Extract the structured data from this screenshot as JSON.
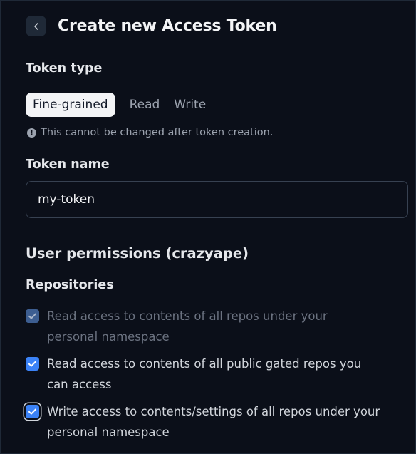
{
  "header": {
    "back_icon": "chevron-left-icon",
    "title": "Create new Access Token"
  },
  "token_type": {
    "label": "Token type",
    "tabs": [
      {
        "label": "Fine-grained",
        "selected": true
      },
      {
        "label": "Read",
        "selected": false
      },
      {
        "label": "Write",
        "selected": false
      }
    ],
    "note_icon": "exclamation-circle-icon",
    "note": "This cannot be changed after token creation."
  },
  "token_name": {
    "label": "Token name",
    "value": "my-token"
  },
  "permissions": {
    "title": "User permissions (crazyape)",
    "repositories": {
      "label": "Repositories",
      "items": [
        {
          "label": "Read access to contents of all repos under your personal namespace",
          "checked": true,
          "disabled": true
        },
        {
          "label": "Read access to contents of all public gated repos you can access",
          "checked": true,
          "disabled": false
        },
        {
          "label": "Write access to contents/settings of all repos under your personal namespace",
          "checked": true,
          "disabled": false,
          "focused": true
        }
      ]
    }
  },
  "colors": {
    "background": "#0b0f19",
    "accent": "#3b82f6",
    "disabled_accent": "#3d5e91"
  }
}
